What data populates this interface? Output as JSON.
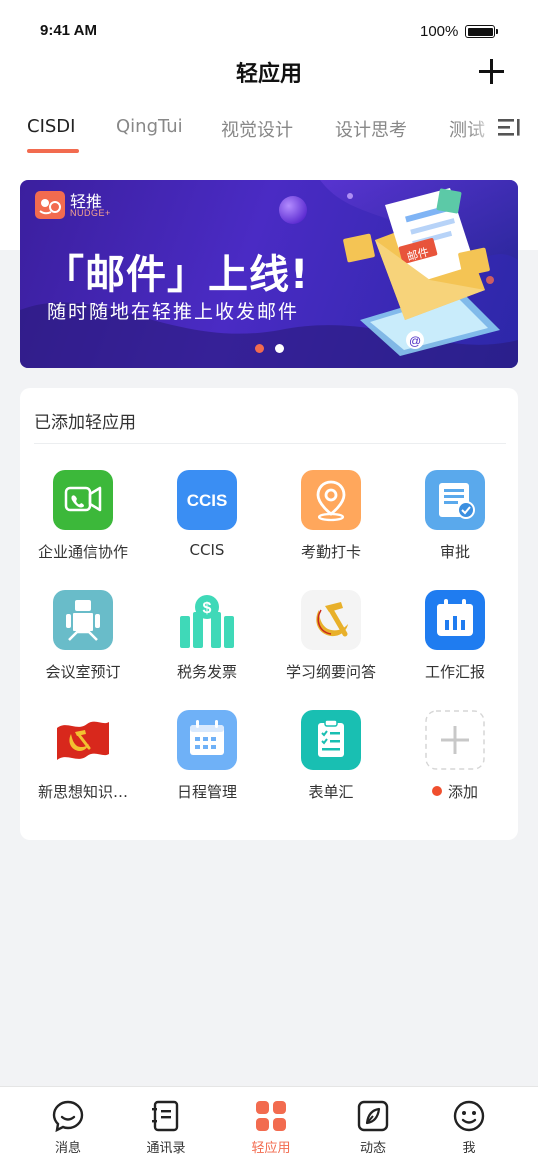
{
  "status_bar": {
    "time": "9:41 AM",
    "battery": "100%"
  },
  "nav": {
    "title": "轻应用"
  },
  "tabs": [
    {
      "label": "CISDI",
      "active": true
    },
    {
      "label": "QingTui",
      "active": false
    },
    {
      "label": "视觉设计",
      "active": false
    },
    {
      "label": "设计思考",
      "active": false
    },
    {
      "label": "测试",
      "active": false
    }
  ],
  "banner": {
    "logo_text": "轻推",
    "logo_sub": "NUDGE+",
    "headline": "「邮件」上线!",
    "subtitle": "随时随地在轻推上收发邮件",
    "envelope_tag": "邮件",
    "page_count": 2,
    "current_page": 1
  },
  "card": {
    "title": "已添加轻应用",
    "apps": [
      {
        "label": "企业通信协作",
        "icon": "video-call-icon",
        "color": "#3cb83a"
      },
      {
        "label": "CCIS",
        "icon": "ccis-logo-icon",
        "color": "#3a8ef3",
        "icon_text": "CCIS"
      },
      {
        "label": "考勤打卡",
        "icon": "location-pin-icon",
        "color": "#ffa75c"
      },
      {
        "label": "审批",
        "icon": "approval-doc-icon",
        "color": "#5aa9ec"
      },
      {
        "label": "会议室预订",
        "icon": "meeting-room-icon",
        "color": "#69bcc9"
      },
      {
        "label": "税务发票",
        "icon": "tax-invoice-icon",
        "color": "#3fd9b8"
      },
      {
        "label": "学习纲要问答",
        "icon": "hammer-sickle-icon",
        "color": "#e8b02a"
      },
      {
        "label": "工作汇报",
        "icon": "calendar-report-icon",
        "color": "#1f7cf0"
      },
      {
        "label": "新思想知识…",
        "icon": "party-flag-icon",
        "color": "#d8281c"
      },
      {
        "label": "日程管理",
        "icon": "schedule-calendar-icon",
        "color": "#6fb1f7"
      },
      {
        "label": "表单汇",
        "icon": "form-clipboard-icon",
        "color": "#19bfb2"
      },
      {
        "label": "添加",
        "icon": "add-icon",
        "color": "#cccccc"
      }
    ]
  },
  "tabbar": [
    {
      "label": "消息",
      "icon": "chat-bubble-icon",
      "active": false
    },
    {
      "label": "通讯录",
      "icon": "contacts-book-icon",
      "active": false
    },
    {
      "label": "轻应用",
      "icon": "apps-grid-icon",
      "active": true
    },
    {
      "label": "动态",
      "icon": "compass-feed-icon",
      "active": false
    },
    {
      "label": "我",
      "icon": "smiley-profile-icon",
      "active": false
    }
  ],
  "colors": {
    "accent": "#f26b4f",
    "banner_bg": "#4a2bc4",
    "page_bg": "#f2f3f5"
  }
}
